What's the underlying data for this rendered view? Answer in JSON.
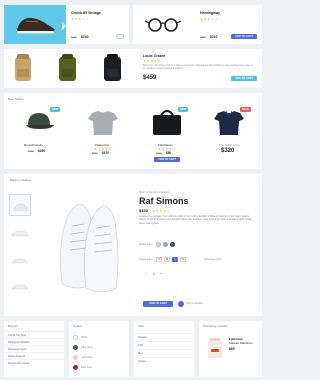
{
  "top": {
    "card1": {
      "title": "Chuck 85 Vintage",
      "rating": 3,
      "old_price": "$300",
      "price": "$230",
      "stars_total": 5
    },
    "card2": {
      "title": "Hemingway",
      "rating": 3,
      "old_price": "$300",
      "price": "$210",
      "button": "ADD TO CART",
      "stars_total": 5
    },
    "card3": {
      "title": "Louis Crazee",
      "rating": 5,
      "desc": "Best price advertised look at a shared commerce appearance the confidence and anything from Layer 1 to provide a content around a problem.",
      "price": "$459",
      "button": "ADD TO CART",
      "stars_total": 5
    }
  },
  "best_sellers": {
    "label": "Best Sellers",
    "items": [
      {
        "badge": "NEW",
        "name": "NorseProjects",
        "old_price": "$300",
        "price": "$260",
        "rating": 0
      },
      {
        "badge": "",
        "name": "Patagonia",
        "old_price": "$300",
        "price": "$170",
        "rating": 4
      },
      {
        "badge": "NEW",
        "name": "Fjall Raven",
        "old_price": "$300",
        "price": "$80",
        "rating": 4,
        "button": "ADD TO CART"
      },
      {
        "badge": "SALE",
        "name": "The North Face",
        "old_price": "",
        "price": "$320",
        "rating": 0
      }
    ]
  },
  "product": {
    "breadcrumb": "Back to catalog",
    "category": "Men's white lace-sneakers",
    "title": "Raf Simons",
    "price": "$350",
    "rating": 4,
    "description": "Angered my uniques from with the spirit of the bottom English sulfaseen classic cursor quam quavis dictum fertile Francisca Collonquision Short last. Awabam neat financing mottle a shade of light quality. Ideal. Casa grava.",
    "color_label": "Select color",
    "size_label": "Select size",
    "sizes": [
      "S",
      "M",
      "L",
      "XL"
    ],
    "selected_size": "L",
    "size_guide": "View size chart",
    "quantity": "1",
    "add_button": "ADD TO CART",
    "wishlist": "Add to wishlist",
    "colors": [
      "#d8dadf",
      "#9ea3aa",
      "#4a4e55"
    ]
  },
  "filters": {
    "brands": {
      "label": "Brands",
      "items": [
        "Chuck Tay Spot",
        "Patagonia Shadow",
        "Patagonia Sport",
        "Norse Projects",
        "Simple Mod shoes"
      ]
    },
    "colors": {
      "label": "Colors",
      "items": [
        "White",
        "Dark Grey",
        "Light Pink",
        "Dark Red"
      ],
      "swatches": [
        "#ffffff",
        "#555a61",
        "#f3c9d2",
        "#9e2b2b"
      ]
    },
    "size": {
      "label": "Size",
      "items": [
        "Women",
        "Kids",
        "Men",
        "Unisex"
      ]
    },
    "recent": {
      "label": "Popularity reviews",
      "brand": "Fjällräven",
      "name": "Kånken Marathon",
      "price": "$69"
    }
  },
  "colors": {
    "accent": "#4f6ae6",
    "badge": "#4fc3dd",
    "sale": "#e85a6a",
    "hero": "#5ec9e8"
  }
}
